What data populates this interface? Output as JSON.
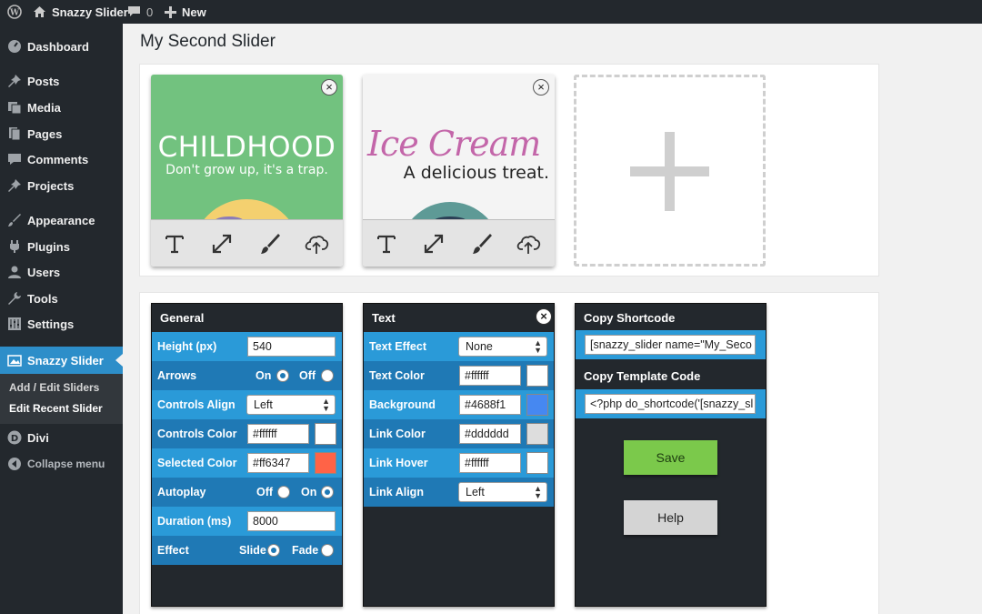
{
  "adminbar": {
    "site_name": "Snazzy Slider",
    "comments_count": "0",
    "new_label": "New"
  },
  "sidebar": {
    "items": [
      {
        "label": "Dashboard",
        "icon": "dashboard-icon"
      },
      {
        "label": "Posts",
        "icon": "pin-icon"
      },
      {
        "label": "Media",
        "icon": "media-icon"
      },
      {
        "label": "Pages",
        "icon": "pages-icon"
      },
      {
        "label": "Comments",
        "icon": "comment-icon"
      },
      {
        "label": "Projects",
        "icon": "pin-icon"
      },
      {
        "label": "Appearance",
        "icon": "brush-icon"
      },
      {
        "label": "Plugins",
        "icon": "plug-icon"
      },
      {
        "label": "Users",
        "icon": "user-icon"
      },
      {
        "label": "Tools",
        "icon": "wrench-icon"
      },
      {
        "label": "Settings",
        "icon": "settings-icon"
      },
      {
        "label": "Snazzy Slider",
        "icon": "slider-icon"
      },
      {
        "label": "Divi",
        "icon": "divi-icon"
      },
      {
        "label": "Collapse menu",
        "icon": "collapse-icon"
      }
    ],
    "submenu": [
      "Add / Edit Sliders",
      "Edit Recent Slider"
    ],
    "active_color": "#2d8ec9"
  },
  "page": {
    "title": "My Second Slider"
  },
  "slides": [
    {
      "title": "CHILDHOOD",
      "subtitle": "Don't grow up, it's a trap.",
      "background": "#72c27f",
      "close": "×"
    },
    {
      "title": "Ice Cream",
      "subtitle": "A delicious treat.",
      "background": "#f4f4f4",
      "title_color": "#c366a9",
      "close": "×"
    }
  ],
  "general": {
    "header": "General",
    "height_label": "Height (px)",
    "height_value": "540",
    "arrows_label": "Arrows",
    "arrows_on": "On",
    "arrows_off": "Off",
    "controls_align_label": "Controls Align",
    "controls_align_value": "Left",
    "controls_color_label": "Controls Color",
    "controls_color_value": "#ffffff",
    "selected_color_label": "Selected Color",
    "selected_color_value": "#ff6347",
    "autoplay_label": "Autoplay",
    "autoplay_off": "Off",
    "autoplay_on": "On",
    "duration_label": "Duration (ms)",
    "duration_value": "8000",
    "effect_label": "Effect",
    "effect_slide": "Slide",
    "effect_fade": "Fade"
  },
  "text": {
    "header": "Text",
    "close": "×",
    "effect_label": "Text Effect",
    "effect_value": "None",
    "text_color_label": "Text Color",
    "text_color_value": "#ffffff",
    "background_label": "Background",
    "background_value": "#4688f1",
    "link_color_label": "Link Color",
    "link_color_value": "#dddddd",
    "link_hover_label": "Link Hover",
    "link_hover_value": "#ffffff",
    "link_align_label": "Link Align",
    "link_align_value": "Left"
  },
  "copy": {
    "shortcode_header": "Copy Shortcode",
    "shortcode_value": "[snazzy_slider name=\"My_Seco",
    "template_header": "Copy Template Code",
    "template_value": "<?php do_shortcode('[snazzy_sl",
    "save_label": "Save",
    "help_label": "Help",
    "save_color": "#7bc94b"
  }
}
